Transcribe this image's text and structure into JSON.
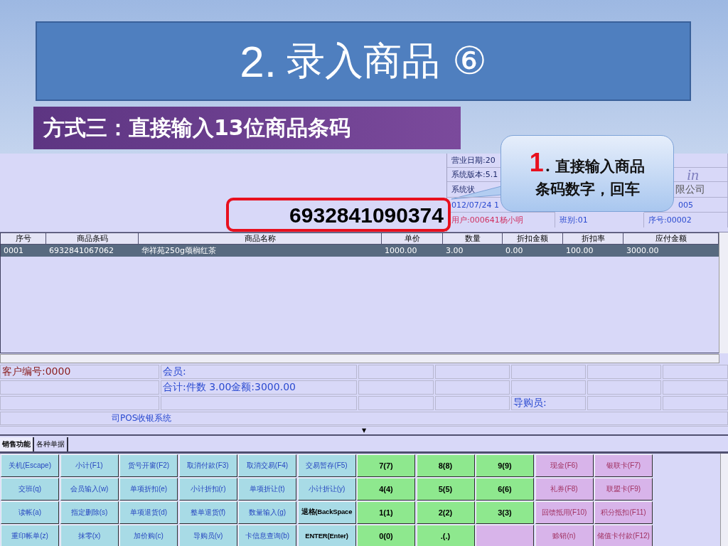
{
  "slide": {
    "title_number": "2.",
    "title": "录入商品 ⑥",
    "subtitle": "方式三：直接输入13位商品条码"
  },
  "callout": {
    "step": "1",
    "line_1": ". 直接输入商品",
    "line_2": "条码数字，回车"
  },
  "pos": {
    "barcode_input": "6932841090374",
    "header_info": [
      {
        "text": "营业日期:20",
        "color": "#1f2a6a"
      },
      {
        "text": "系统版本:5.1",
        "color": "#1f2a6a"
      },
      {
        "text": "系统状",
        "color": "#1f2a6a"
      },
      {
        "text": "012/07/24 1",
        "color": "#2a4ad0"
      },
      {
        "text": "用户:000641杨小明",
        "color": "#d03060"
      },
      {
        "text": "班别:01",
        "color": "#2a4ad0"
      },
      {
        "text": "序号:00002",
        "color": "#2a4ad0"
      }
    ],
    "logo_fragment": "in",
    "company_fragment": "限公司",
    "number_fragment": "005",
    "table": {
      "columns": [
        "序号",
        "商品条码",
        "商品名称",
        "单价",
        "数量",
        "折扣金额",
        "折扣率",
        "应付金额"
      ],
      "rows": [
        {
          "selected": true,
          "cells": [
            "0001",
            "6932841067062",
            "华祥苑250g颂榈红茶",
            "1000.00",
            "3.00",
            "0.00",
            "100.00",
            "3000.00"
          ]
        }
      ]
    },
    "info_rows": [
      [
        {
          "kind": "text",
          "text": "客户编号:0000",
          "color": "#8b2020"
        },
        {
          "kind": "text",
          "text": "会员:",
          "color": "#2a4ad0"
        },
        {
          "kind": "empty"
        },
        {
          "kind": "empty"
        },
        {
          "kind": "empty"
        },
        {
          "kind": "empty"
        },
        {
          "kind": "empty"
        }
      ],
      [
        {
          "kind": "empty"
        },
        {
          "kind": "text",
          "text": "合计:件数 3.00金额:3000.00",
          "color": "#2a4ad0"
        },
        {
          "kind": "empty"
        },
        {
          "kind": "empty"
        },
        {
          "kind": "empty"
        },
        {
          "kind": "empty"
        },
        {
          "kind": "empty"
        }
      ],
      [
        {
          "kind": "empty"
        },
        {
          "kind": "empty"
        },
        {
          "kind": "empty"
        },
        {
          "kind": "empty"
        },
        {
          "kind": "text",
          "text": "导购员:",
          "color": "#2a4ad0"
        },
        {
          "kind": "empty"
        },
        {
          "kind": "empty"
        }
      ]
    ],
    "system_name": "司POS收银系统",
    "dropdown_arrow": "▼",
    "tabs": [
      {
        "label": "销售功能",
        "selected": true
      },
      {
        "label": "各种单据",
        "selected": false
      }
    ],
    "keys": [
      {
        "kind": "function",
        "label": "关机(Escape)"
      },
      {
        "kind": "function",
        "label": "小计(F1)"
      },
      {
        "kind": "function",
        "label": "货号开窗(F2)"
      },
      {
        "kind": "function",
        "label": "取消付款(F3)"
      },
      {
        "kind": "function",
        "label": "取消交易(F4)"
      },
      {
        "kind": "function",
        "label": "交易暂存(F5)"
      },
      {
        "kind": "number",
        "label": "7(7)"
      },
      {
        "kind": "number",
        "label": "8(8)"
      },
      {
        "kind": "number",
        "label": "9(9)"
      },
      {
        "kind": "payment",
        "label": "现金(F6)"
      },
      {
        "kind": "payment",
        "label": "银联卡(F7)"
      },
      {
        "kind": "function",
        "label": "交班(q)"
      },
      {
        "kind": "function",
        "label": "会员输入(w)"
      },
      {
        "kind": "function",
        "label": "单项折扣(e)"
      },
      {
        "kind": "function",
        "label": "小计折扣(r)"
      },
      {
        "kind": "function",
        "label": "单项折让(t)"
      },
      {
        "kind": "function",
        "label": "小计折让(y)"
      },
      {
        "kind": "number",
        "label": "4(4)"
      },
      {
        "kind": "number",
        "label": "5(5)"
      },
      {
        "kind": "number",
        "label": "6(6)"
      },
      {
        "kind": "payment",
        "label": "礼券(F8)"
      },
      {
        "kind": "payment",
        "label": "联盟卡(F9)"
      },
      {
        "kind": "function",
        "label": "读帐(a)"
      },
      {
        "kind": "function",
        "label": "指定删除(s)"
      },
      {
        "kind": "function",
        "label": "单项退货(d)"
      },
      {
        "kind": "function",
        "label": "整单退货(f)"
      },
      {
        "kind": "function",
        "label": "数量输入(g)"
      },
      {
        "kind": "edit",
        "label": "退格(BackSpace"
      },
      {
        "kind": "number",
        "label": "1(1)"
      },
      {
        "kind": "number",
        "label": "2(2)"
      },
      {
        "kind": "number",
        "label": "3(3)"
      },
      {
        "kind": "payment",
        "label": "回馈抵用(F10)"
      },
      {
        "kind": "payment",
        "label": "积分抵扣(F11)"
      },
      {
        "kind": "function",
        "label": "重印帐单(z)"
      },
      {
        "kind": "function",
        "label": "抹零(x)"
      },
      {
        "kind": "function",
        "label": "加价购(c)"
      },
      {
        "kind": "function",
        "label": "导购员(v)"
      },
      {
        "kind": "function",
        "label": "卡信息查询(b)"
      },
      {
        "kind": "edit",
        "label": "ENTER(Enter)"
      },
      {
        "kind": "number",
        "label": "0(0)"
      },
      {
        "kind": "number",
        "label": ".(.)"
      },
      {
        "kind": "payment"
      },
      {
        "kind": "payment",
        "label": "赊销(n)"
      },
      {
        "kind": "payment",
        "label": "储值卡付款(F12)"
      }
    ]
  }
}
